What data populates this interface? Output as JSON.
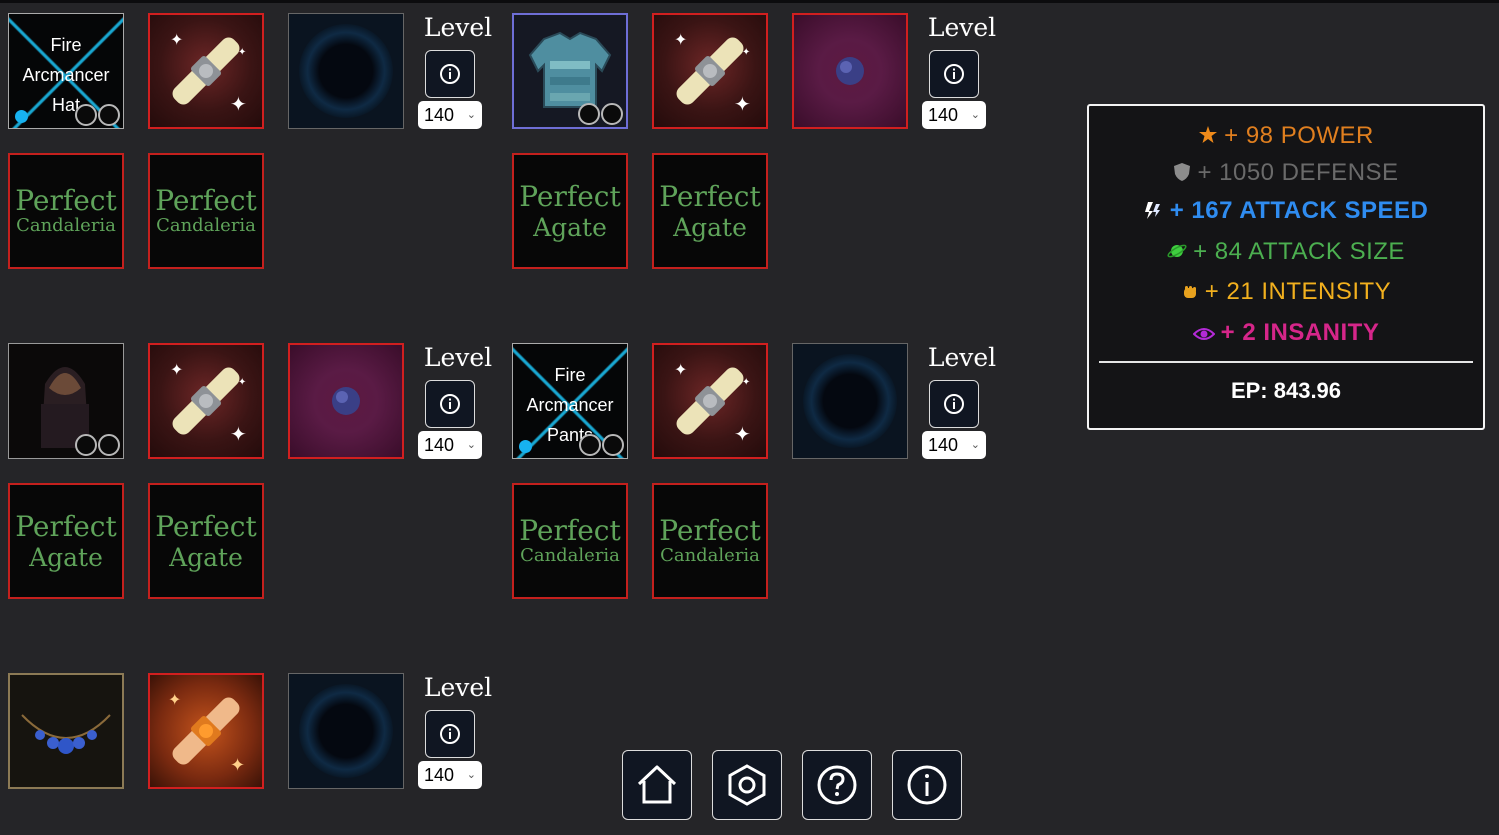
{
  "groups": [
    {
      "item": {
        "name_line1": "Fire",
        "name_line2": "Arcmancer",
        "name_line3": "Hat",
        "icon": "fire-arcmancer-hat"
      },
      "enchant_scroll": {
        "icon": "white-enchant-scroll-icon"
      },
      "rune_slot": {
        "icon": "empty-blue-orb-icon"
      },
      "gems": [
        {
          "line1": "Perfect",
          "line2": "Candaleria"
        },
        {
          "line1": "Perfect",
          "line2": "Candaleria"
        }
      ],
      "level_label": "Level",
      "level_value": "140"
    },
    {
      "item": {
        "icon": "teal-chest-armor-icon"
      },
      "enchant_scroll": {
        "icon": "white-enchant-scroll-icon"
      },
      "rune_slot": {
        "icon": "purple-orb-icon"
      },
      "gems": [
        {
          "line1": "Perfect",
          "line2": "Agate"
        },
        {
          "line1": "Perfect",
          "line2": "Agate"
        }
      ],
      "level_label": "Level",
      "level_value": "140"
    },
    {
      "item": {
        "icon": "dark-hood-cloak-icon"
      },
      "enchant_scroll": {
        "icon": "white-enchant-scroll-icon"
      },
      "rune_slot": {
        "icon": "purple-orb-icon"
      },
      "gems": [
        {
          "line1": "Perfect",
          "line2": "Agate"
        },
        {
          "line1": "Perfect",
          "line2": "Agate"
        }
      ],
      "level_label": "Level",
      "level_value": "140"
    },
    {
      "item": {
        "name_line1": "Fire",
        "name_line2": "Arcmancer",
        "name_line3": "Pants",
        "icon": "fire-arcmancer-pants"
      },
      "enchant_scroll": {
        "icon": "white-enchant-scroll-icon"
      },
      "rune_slot": {
        "icon": "empty-blue-orb-icon"
      },
      "gems": [
        {
          "line1": "Perfect",
          "line2": "Candaleria"
        },
        {
          "line1": "Perfect",
          "line2": "Candaleria"
        }
      ],
      "level_label": "Level",
      "level_value": "140"
    },
    {
      "item": {
        "icon": "sapphire-necklace-icon"
      },
      "enchant_scroll": {
        "icon": "orange-enchant-scroll-icon"
      },
      "rune_slot": {
        "icon": "empty-blue-orb-icon"
      },
      "level_label": "Level",
      "level_value": "140"
    }
  ],
  "stats": {
    "power": {
      "text": "+ 98 POWER",
      "color": "#e07f1f",
      "icon": "star-icon"
    },
    "defense": {
      "text": "+ 1050 DEFENSE",
      "color": "#6a6a6a",
      "icon": "shield-icon"
    },
    "attack_speed": {
      "text": "+ 167 ATTACK SPEED",
      "color": "#2f8cf0",
      "icon": "speed-icon"
    },
    "attack_size": {
      "text": "+ 84 ATTACK SIZE",
      "color": "#4caf50",
      "icon": "planet-icon"
    },
    "intensity": {
      "text": "+ 21 INTENSITY",
      "color": "#f2b01e",
      "icon": "fist-icon"
    },
    "insanity": {
      "text": "+ 2 INSANITY",
      "color": "#d6268a",
      "icon": "eye-icon"
    },
    "ep": "EP: 843.96"
  },
  "nav": [
    "home-icon",
    "settings-icon",
    "help-icon",
    "info-icon"
  ]
}
